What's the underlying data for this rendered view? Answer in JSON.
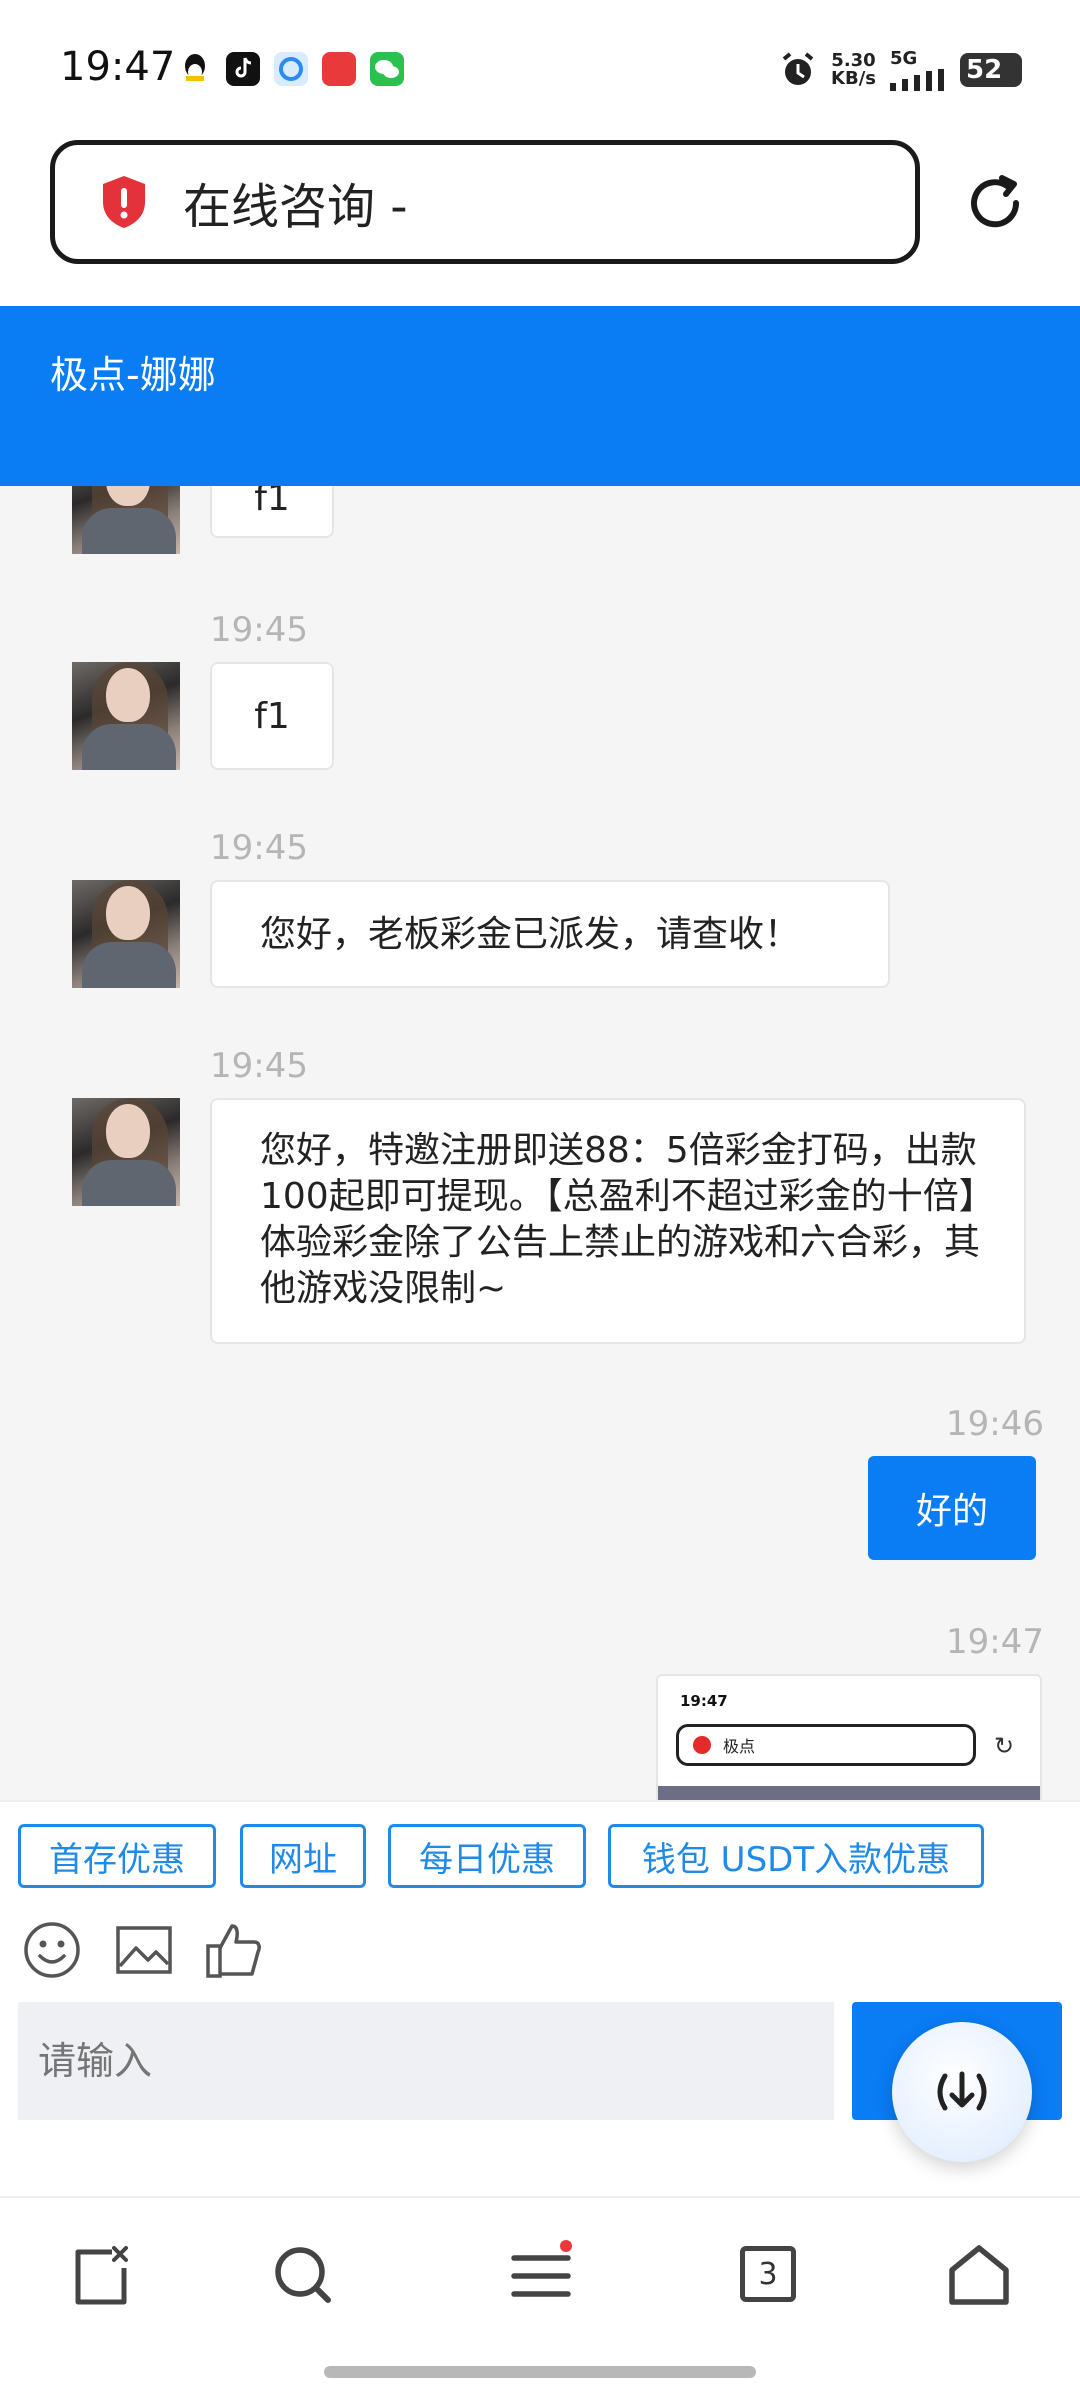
{
  "status_bar": {
    "time": "19:47",
    "net_speed_value": "5.30",
    "net_speed_unit": "KB/s",
    "network": "5G",
    "battery": "52"
  },
  "browser": {
    "url_text": "在线咨询 -"
  },
  "chat": {
    "title": "极点-娜娜",
    "messages": [
      {
        "time": "",
        "text": "f1"
      },
      {
        "time": "19:45",
        "text": "f1"
      },
      {
        "time": "19:45",
        "text": "您好，老板彩金已派发，请查收！"
      },
      {
        "time": "19:45",
        "text": "您好，特邀注册即送88：5倍彩金打码，出款100起即可提现。【总盈利不超过彩金的十倍】体验彩金除了公告上禁止的游戏和六合彩，其他游戏没限制~"
      },
      {
        "time": "19:46",
        "text": "好的"
      },
      {
        "time": "19:47",
        "text": ""
      }
    ],
    "screenshot_preview": {
      "time": "19:47",
      "url_text": "极点"
    }
  },
  "quick_replies": [
    "首存优惠",
    "网址",
    "每日优惠",
    "钱包 USDT入款优惠"
  ],
  "input": {
    "placeholder": "请输入"
  },
  "nav": {
    "tab_count": "3"
  }
}
